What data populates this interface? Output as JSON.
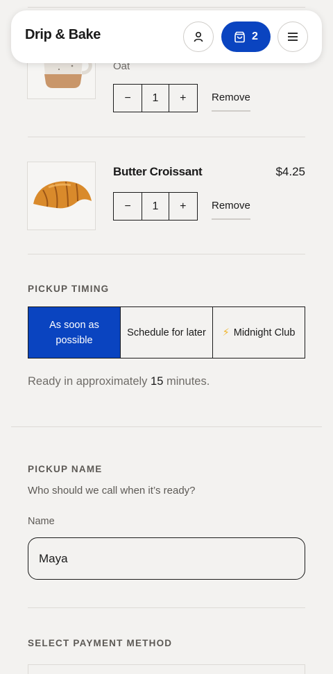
{
  "header": {
    "brand": "Drip & Bake",
    "cart_count": "2"
  },
  "cart": {
    "items": [
      {
        "variant": "Oat",
        "quantity": "1",
        "remove_label": "Remove",
        "decrement": "−",
        "increment": "+"
      },
      {
        "name": "Butter Croissant",
        "price": "$4.25",
        "quantity": "1",
        "remove_label": "Remove",
        "decrement": "−",
        "increment": "+"
      }
    ]
  },
  "pickup_timing": {
    "label": "PICKUP TIMING",
    "options": [
      "As soon as possible",
      "Schedule for later",
      "Midnight Club"
    ],
    "selected": 0,
    "ready_prefix": "Ready in approximately ",
    "ready_minutes": "15",
    "ready_suffix": " minutes."
  },
  "pickup_name": {
    "label": "PICKUP NAME",
    "hint": "Who should we call when it’s ready?",
    "field_label": "Name",
    "value": "Maya"
  },
  "payment": {
    "label": "SELECT PAYMENT METHOD"
  },
  "colors": {
    "accent": "#0a44c0",
    "background": "#f3f2f0",
    "bolt": "#f0b429"
  }
}
